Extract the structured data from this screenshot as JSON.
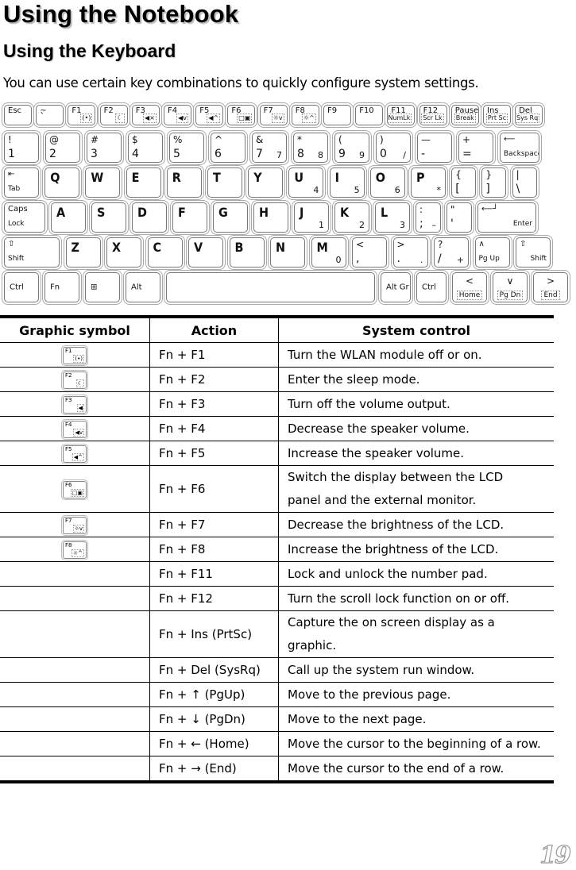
{
  "heading": "Using the Notebook",
  "subheading": "Using the Keyboard",
  "intro": "You can use certain key combinations to quickly configure system settings.",
  "keyboard": {
    "row1": [
      {
        "top": "Esc"
      },
      {
        "top": "~",
        "bottom": "`"
      },
      {
        "label": "F1",
        "icon": "(•)",
        "icon_name": "wlan-icon"
      },
      {
        "label": "F2",
        "icon": "☾",
        "icon_name": "sleep-icon"
      },
      {
        "label": "F3",
        "icon": "◀×",
        "icon_name": "mute-icon"
      },
      {
        "label": "F4",
        "icon": "◀v",
        "icon_name": "volume-down-icon"
      },
      {
        "label": "F5",
        "icon": "◀^",
        "icon_name": "volume-up-icon"
      },
      {
        "label": "F6",
        "icon": "□▣",
        "icon_name": "display-switch-icon"
      },
      {
        "label": "F7",
        "icon": "☼v",
        "icon_name": "brightness-down-icon"
      },
      {
        "label": "F8",
        "icon": "☼^",
        "icon_name": "brightness-up-icon"
      },
      {
        "label": "F9"
      },
      {
        "label": "F10"
      },
      {
        "label": "F11",
        "icon": "NumLk"
      },
      {
        "label": "F12",
        "icon": "Scr Lk"
      },
      {
        "label": "Pause",
        "icon": "Break"
      },
      {
        "label": "Ins",
        "icon": "Prt Sc"
      },
      {
        "label": "Del",
        "icon": "Sys Rq"
      }
    ],
    "row2": [
      {
        "top": "!",
        "bottom": "1"
      },
      {
        "top": "@",
        "bottom": "2"
      },
      {
        "top": "#",
        "bottom": "3"
      },
      {
        "top": "$",
        "bottom": "4"
      },
      {
        "top": "%",
        "bottom": "5"
      },
      {
        "top": "^",
        "bottom": "6"
      },
      {
        "top": "&",
        "bottom": "7",
        "num": "7"
      },
      {
        "top": "*",
        "bottom": "8",
        "num": "8"
      },
      {
        "top": "(",
        "bottom": "9",
        "num": "9"
      },
      {
        "top": ")",
        "bottom": "0",
        "num": "/"
      },
      {
        "top": "—",
        "bottom": "-"
      },
      {
        "top": "+",
        "bottom": "="
      },
      {
        "top": "⟵",
        "bottom": "Backspace"
      }
    ],
    "row3": [
      {
        "top": "⇤",
        "bottom": "Tab"
      },
      {
        "big": "Q"
      },
      {
        "big": "W"
      },
      {
        "big": "E"
      },
      {
        "big": "R"
      },
      {
        "big": "T"
      },
      {
        "big": "Y"
      },
      {
        "big": "U",
        "num": "4"
      },
      {
        "big": "I",
        "num": "5"
      },
      {
        "big": "O",
        "num": "6"
      },
      {
        "big": "P",
        "num": "*"
      },
      {
        "top": "{",
        "bottom": "["
      },
      {
        "top": "}",
        "bottom": "]"
      },
      {
        "top": "|",
        "bottom": "\\"
      }
    ],
    "row4": [
      {
        "top": "Caps",
        "bottom": "Lock"
      },
      {
        "big": "A"
      },
      {
        "big": "S"
      },
      {
        "big": "D"
      },
      {
        "big": "F"
      },
      {
        "big": "G"
      },
      {
        "big": "H"
      },
      {
        "big": "J",
        "num": "1"
      },
      {
        "big": "K",
        "num": "2"
      },
      {
        "big": "L",
        "num": "3"
      },
      {
        "top": ":",
        "bottom": ";",
        "num": "–"
      },
      {
        "top": "\"",
        "bottom": "'"
      },
      {
        "top": "⟵┘",
        "bottom": "Enter"
      }
    ],
    "row5": [
      {
        "top": "⇧",
        "bottom": "Shift"
      },
      {
        "big": "Z"
      },
      {
        "big": "X"
      },
      {
        "big": "C"
      },
      {
        "big": "V"
      },
      {
        "big": "B"
      },
      {
        "big": "N"
      },
      {
        "big": "M",
        "num": "0"
      },
      {
        "top": "<",
        "bottom": ","
      },
      {
        "top": ">",
        "bottom": ".",
        "num": "."
      },
      {
        "top": "?",
        "bottom": "/",
        "num": "+"
      },
      {
        "top": "∧",
        "bottom": "Pg Up"
      },
      {
        "top": "⇧",
        "bottom": "Shift"
      }
    ],
    "row6": [
      {
        "top": "Ctrl"
      },
      {
        "top": "Fn"
      },
      {
        "top": "⊞",
        "icon_name": "windows-logo-icon"
      },
      {
        "top": "Alt"
      },
      {
        "top": ""
      },
      {
        "top": "Alt Gr"
      },
      {
        "top": "Ctrl"
      },
      {
        "top": "<",
        "bottom": "Home"
      },
      {
        "top": "∨",
        "bottom": "Pg Dn"
      },
      {
        "top": ">",
        "bottom": "End"
      }
    ]
  },
  "table": {
    "headers": [
      "Graphic symbol",
      "Action",
      "System control"
    ],
    "rows": [
      {
        "symbol_label": "F1",
        "symbol_icon": "(•)",
        "action": "Fn + F1",
        "control": "Turn the WLAN module off or on."
      },
      {
        "symbol_label": "F2",
        "symbol_icon": "☾",
        "action": "Fn + F2",
        "control": "Enter the sleep mode."
      },
      {
        "symbol_label": "F3",
        "symbol_icon": "◀",
        "action": "Fn + F3",
        "control": "Turn off the volume output."
      },
      {
        "symbol_label": "F4",
        "symbol_icon": "◀v",
        "action": "Fn + F4",
        "control": "Decrease the speaker volume."
      },
      {
        "symbol_label": "F5",
        "symbol_icon": "◀^",
        "action": "Fn + F5",
        "control": "Increase the speaker volume."
      },
      {
        "symbol_label": "F6",
        "symbol_icon": "□▣",
        "action": "Fn + F6",
        "control": "Switch the display between the LCD panel and the external monitor."
      },
      {
        "symbol_label": "F7",
        "symbol_icon": "☼v",
        "action": "Fn + F7",
        "control": "Decrease the brightness of the LCD."
      },
      {
        "symbol_label": "F8",
        "symbol_icon": "☼^",
        "action": "Fn + F8",
        "control": "Increase the brightness of the LCD."
      },
      {
        "symbol_label": "",
        "symbol_icon": "",
        "action": "Fn + F11",
        "control": "Lock and unlock the number pad."
      },
      {
        "symbol_label": "",
        "symbol_icon": "",
        "action": "Fn + F12",
        "control": "Turn the scroll lock function on or off."
      },
      {
        "symbol_label": "",
        "symbol_icon": "",
        "action": "Fn + Ins (PrtSc)",
        "control": "Capture the on screen display as a graphic."
      },
      {
        "symbol_label": "",
        "symbol_icon": "",
        "action": "Fn + Del (SysRq)",
        "control": "Call up the system run window."
      },
      {
        "symbol_label": "",
        "symbol_icon": "",
        "action": "Fn +  ↑  (PgUp)",
        "control": "Move to the previous page."
      },
      {
        "symbol_label": "",
        "symbol_icon": "",
        "action": "Fn +  ↓  (PgDn)",
        "control": "Move to the next page."
      },
      {
        "symbol_label": "",
        "symbol_icon": "",
        "action": "Fn + ← (Home)",
        "control": "Move the cursor to the beginning of a row."
      },
      {
        "symbol_label": "",
        "symbol_icon": "",
        "action": "Fn + → (End)",
        "control": "Move the cursor to the end of a row."
      }
    ]
  },
  "page_number": "19"
}
